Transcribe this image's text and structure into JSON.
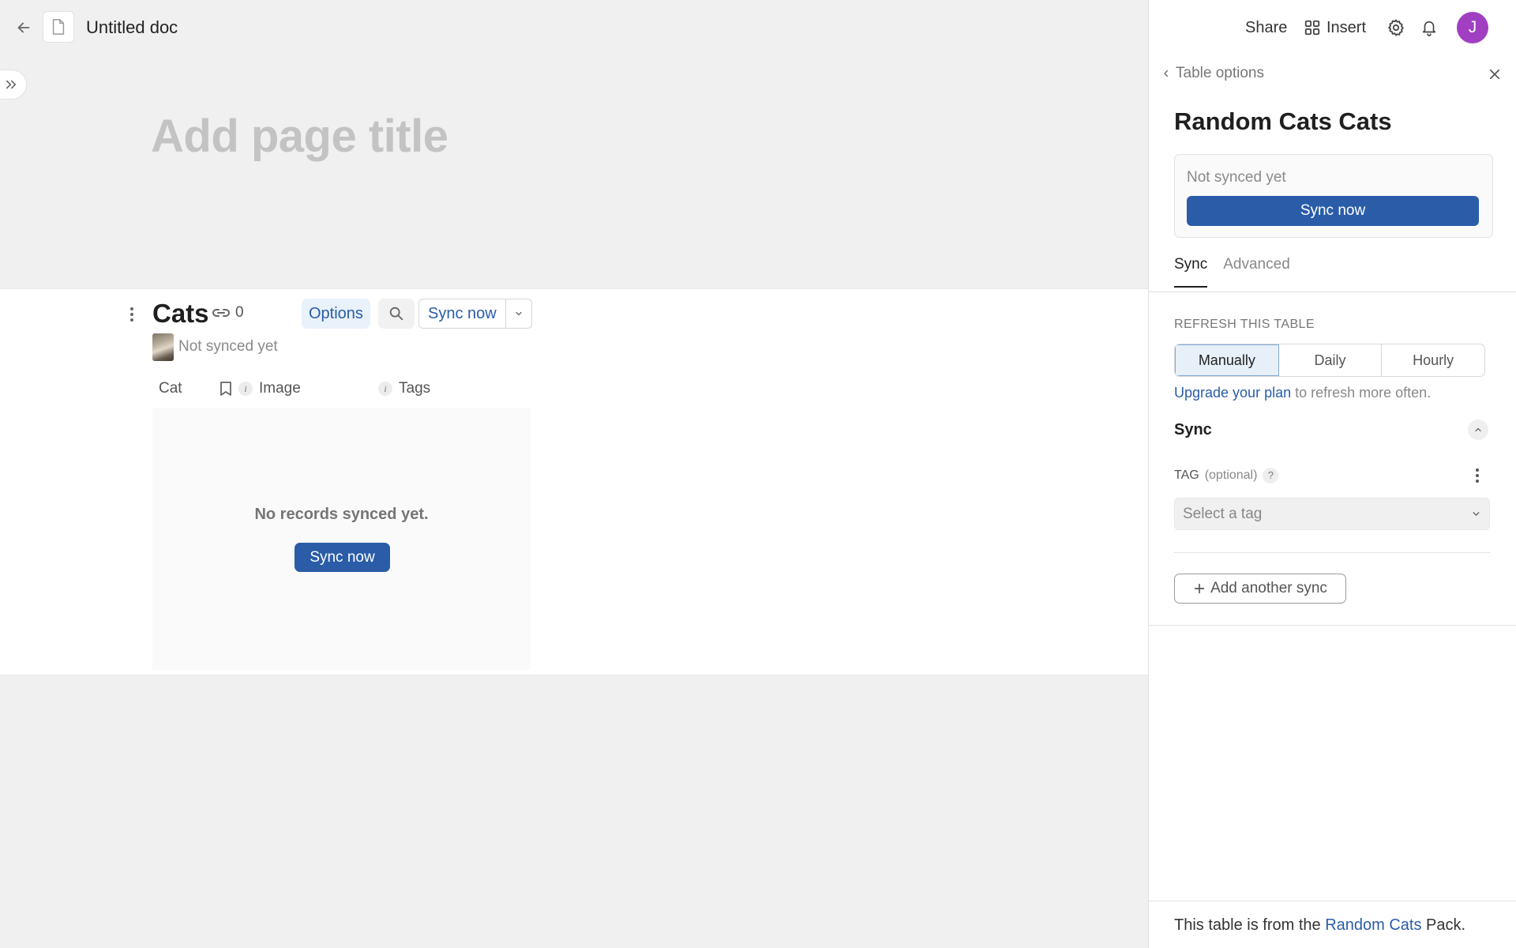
{
  "doc": {
    "title": "Untitled doc",
    "page_title_placeholder": "Add page title"
  },
  "table": {
    "name": "Cats",
    "link_count": "0",
    "options_label": "Options",
    "sync_label": "Sync now",
    "status": "Not synced yet",
    "columns": [
      "Cat",
      "Image",
      "Tags"
    ],
    "info_glyph": "i",
    "empty_text": "No records synced yet.",
    "empty_sync_label": "Sync now"
  },
  "header": {
    "share": "Share",
    "insert": "Insert",
    "avatar_initial": "J",
    "avatar_color": "#a13fc3"
  },
  "panel": {
    "breadcrumb": "Table options",
    "title": "Random Cats Cats",
    "status": "Not synced yet",
    "sync_button": "Sync now",
    "tabs": [
      "Sync",
      "Advanced"
    ],
    "active_tab": "Sync",
    "refresh_label": "REFRESH THIS TABLE",
    "refresh_options": [
      "Manually",
      "Daily",
      "Hourly"
    ],
    "refresh_selected": "Manually",
    "upgrade_link": "Upgrade your plan",
    "upgrade_rest": " to refresh more often.",
    "sync_section": "Sync",
    "tag_label": "TAG",
    "tag_optional": "(optional)",
    "help_glyph": "?",
    "tag_placeholder": "Select a tag",
    "add_sync": "Add another sync",
    "footer_prefix": "This table is from the ",
    "footer_link": "Random Cats",
    "footer_suffix": " Pack."
  },
  "icons": [
    "arrow-left-icon",
    "document-icon",
    "double-chevron-right-icon",
    "kebab-icon",
    "link-icon",
    "search-icon",
    "chevron-down-icon",
    "bookmark-icon",
    "info-icon",
    "grid-icon",
    "gear-icon",
    "bell-icon",
    "chevron-left-icon",
    "close-icon",
    "chevron-up-icon",
    "help-icon",
    "plus-icon"
  ],
  "colors": {
    "accent": "#2a5ca8",
    "accent_light": "#e9f1fb",
    "page_bg": "#f0f0f0"
  }
}
